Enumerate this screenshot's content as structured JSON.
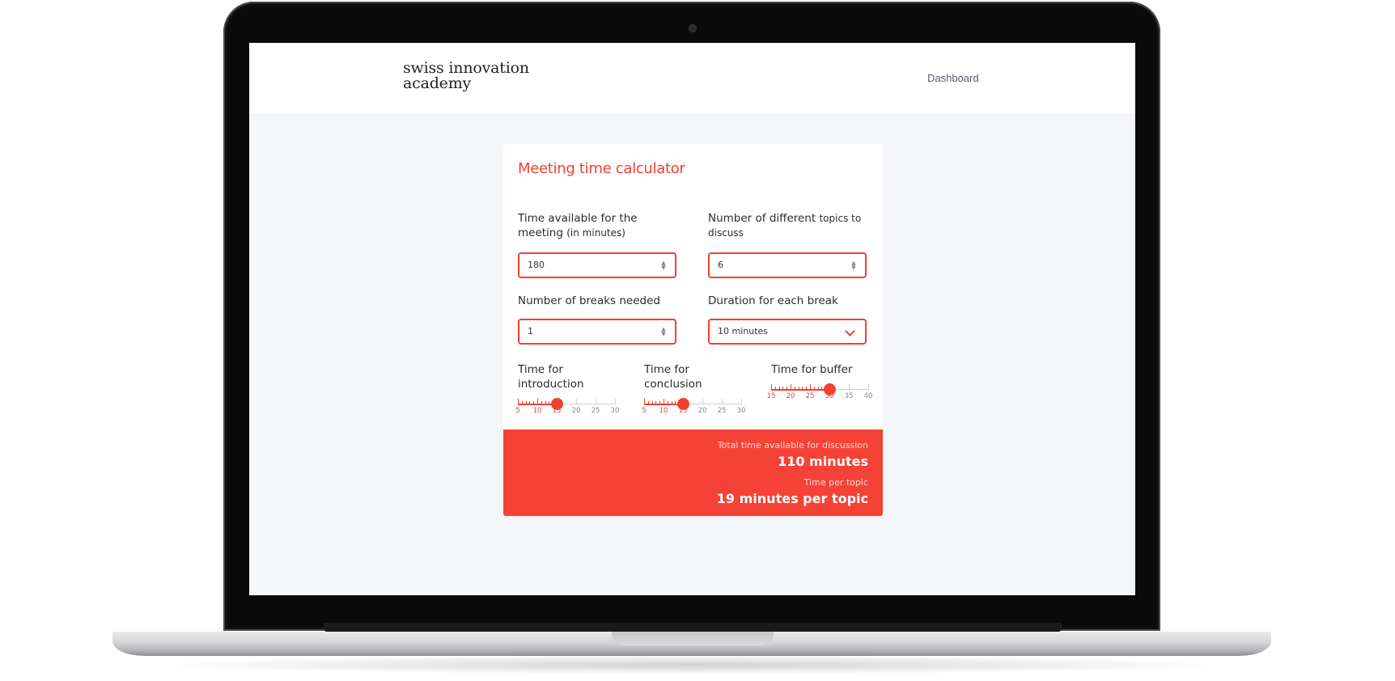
{
  "brand": {
    "name": "swiss innovation academy",
    "line1": "swiss innovation",
    "line2": "academy"
  },
  "nav": {
    "dashboard": "Dashboard"
  },
  "calculator": {
    "title": "Meeting time calculator",
    "time_available": {
      "label": "Time available for the meeting",
      "label_suffix": "(in minutes)",
      "value": "180"
    },
    "topics": {
      "label": "Number of different",
      "label_suffix": "topics to discuss",
      "value": "6"
    },
    "breaks": {
      "label": "Number of breaks needed",
      "value": "1"
    },
    "break_duration": {
      "label": "Duration for each break",
      "value": "10 minutes"
    },
    "intro": {
      "label": "Time for introduction",
      "value": 15,
      "min": 5,
      "max": 30,
      "ticks": [
        "5",
        "10",
        "15",
        "20",
        "25",
        "30"
      ]
    },
    "conclusion": {
      "label": "Time for conclusion",
      "value": 15,
      "min": 5,
      "max": 30,
      "ticks": [
        "5",
        "10",
        "15",
        "20",
        "25",
        "30"
      ]
    },
    "buffer": {
      "label": "Time for buffer",
      "value": 30,
      "min": 15,
      "max": 40,
      "ticks": [
        "15",
        "20",
        "25",
        "30",
        "35",
        "40"
      ]
    }
  },
  "result": {
    "total_label": "Total time available for discussion",
    "total_value": "110 minutes",
    "per_topic_label": "Time per topic",
    "per_topic_value": "19 minutes per topic"
  },
  "colors": {
    "accent": "#f0412f",
    "result_bg": "#f44336",
    "page_bg": "#f5f6fa"
  }
}
